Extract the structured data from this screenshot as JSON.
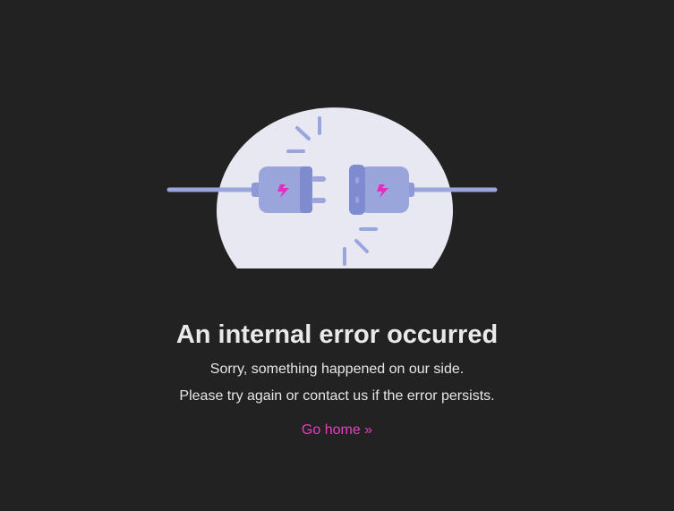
{
  "illustration": {
    "name": "unplugged-cable",
    "colors": {
      "background": "#222222",
      "dome": "#e8e8f3",
      "plug": "#9aa5dc",
      "plug_dark": "#7f8bcf",
      "bolt": "#e62cc0"
    }
  },
  "error": {
    "title": "An internal error occurred",
    "line1": "Sorry, something happened on our side.",
    "line2": "Please try again or contact us if the error persists."
  },
  "actions": {
    "home_label": "Go home »"
  }
}
